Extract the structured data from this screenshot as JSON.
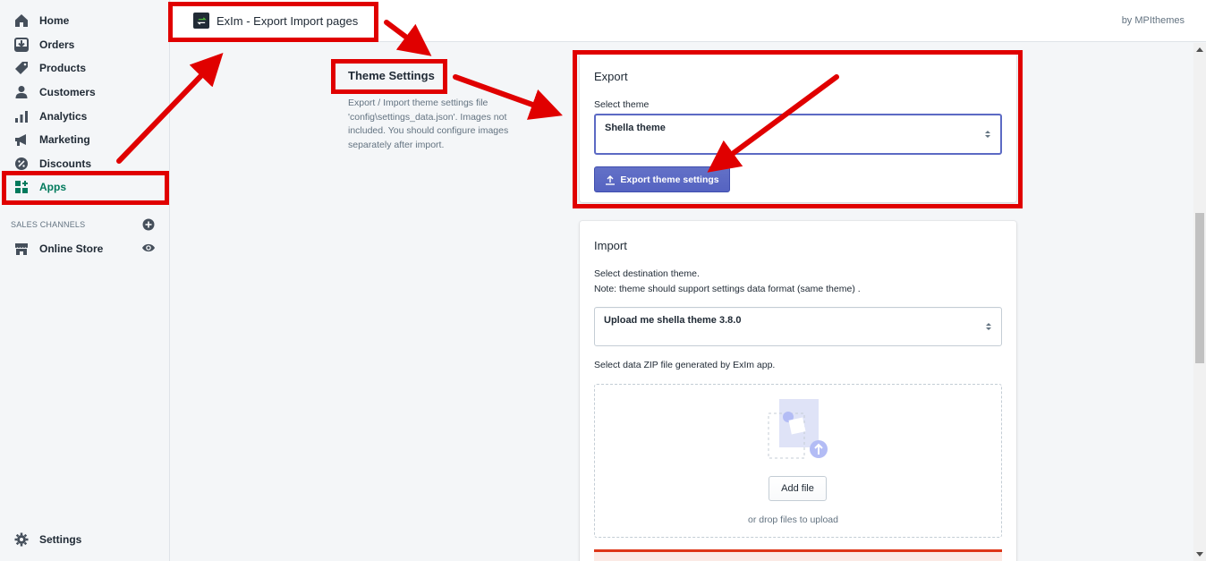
{
  "sidebar": {
    "items": [
      {
        "label": "Home",
        "icon": "home-icon"
      },
      {
        "label": "Orders",
        "icon": "orders-icon"
      },
      {
        "label": "Products",
        "icon": "tag-icon"
      },
      {
        "label": "Customers",
        "icon": "person-icon"
      },
      {
        "label": "Analytics",
        "icon": "bar-chart-icon"
      },
      {
        "label": "Marketing",
        "icon": "megaphone-icon"
      },
      {
        "label": "Discounts",
        "icon": "discount-icon"
      },
      {
        "label": "Apps",
        "icon": "apps-icon"
      }
    ],
    "sales_channels_title": "SALES CHANNELS",
    "online_store": "Online Store",
    "settings": "Settings"
  },
  "topbar": {
    "app_name": "ExIm - Export Import pages",
    "byline": "by MPIthemes"
  },
  "theme_settings": {
    "title": "Theme Settings",
    "description": "Export / Import theme settings file 'config\\settings_data.json'. Images not included. You should configure images separately after import."
  },
  "export": {
    "title": "Export",
    "select_label": "Select theme",
    "selected_theme": "Shella theme",
    "button_label": "Export theme settings"
  },
  "import": {
    "title": "Import",
    "destination_label": "Select destination theme.",
    "destination_note": "Note: theme should support settings data format (same theme) .",
    "selected_theme": "Upload me shella theme 3.8.0",
    "zip_label": "Select data ZIP file generated by ExIm app.",
    "add_file": "Add file",
    "drop_hint": "or drop files to upload"
  },
  "colors": {
    "accent": "#5c6ac4",
    "active_nav": "#007a5c",
    "annotation": "#e00000"
  }
}
